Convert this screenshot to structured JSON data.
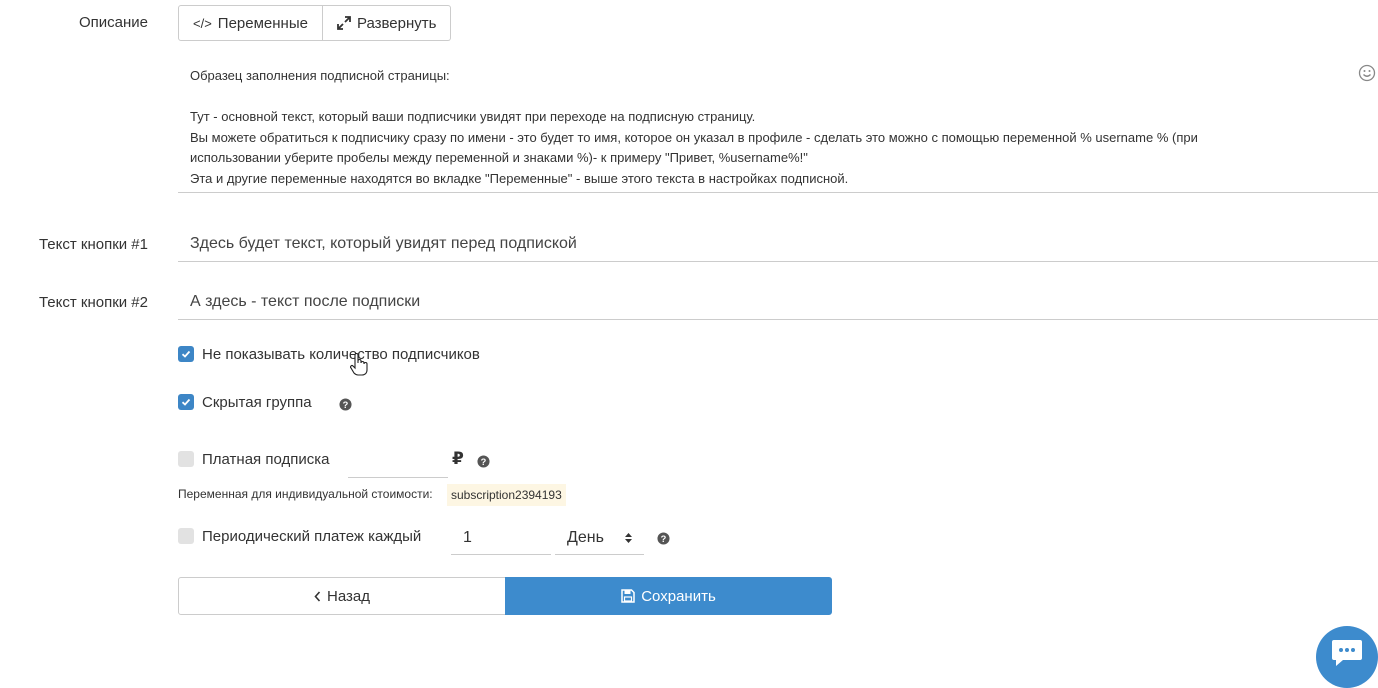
{
  "description": {
    "label": "Описание",
    "variables_button": "Переменные",
    "expand_button": "Развернуть",
    "lines": [
      "Образец заполнения подписной страницы:",
      "",
      "Тут - основной текст, который ваши подписчики увидят при переходе на подписную страницу.",
      "Вы можете обратиться к подписчику сразу по имени - это будет то имя, которое он указал в профиле - сделать это можно с помощью переменной % username % (при",
      "использовании уберите пробелы между переменной и знаками %)- к примеру \"Привет, %username%!\"",
      "Эта и другие переменные находятся во вкладке \"Переменные\" - выше этого текста в настройках подписной."
    ]
  },
  "button1": {
    "label": "Текст кнопки #1",
    "value": "Здесь будет текст, который увидят перед подпиской"
  },
  "button2": {
    "label": "Текст кнопки #2",
    "value": "А здесь - текст после подписки"
  },
  "options": {
    "hide_count": {
      "label": "Не показывать количество подписчиков",
      "checked": true
    },
    "hidden_group": {
      "label": "Скрытая группа",
      "checked": true
    },
    "paid": {
      "label": "Платная подписка",
      "checked": false,
      "price": "",
      "currency": "₽"
    },
    "individual_cost": {
      "label": "Переменная для индивидуальной стоимости:",
      "variable": "subscription2394193"
    },
    "periodic": {
      "label": "Периодический платеж каждый",
      "checked": false,
      "count": "1",
      "period": "День"
    }
  },
  "actions": {
    "back": "Назад",
    "save": "Сохранить"
  },
  "colors": {
    "accent": "#3d8bcd",
    "checkbox_on": "#3d86c6",
    "chip_bg": "#fdf6e3"
  },
  "icons": [
    "code-icon",
    "expand-icon",
    "smile-icon",
    "question-icon",
    "ruble-icon",
    "chevron-left-icon",
    "floppy-disk-icon",
    "chat-icon",
    "cursor-hand-icon"
  ]
}
